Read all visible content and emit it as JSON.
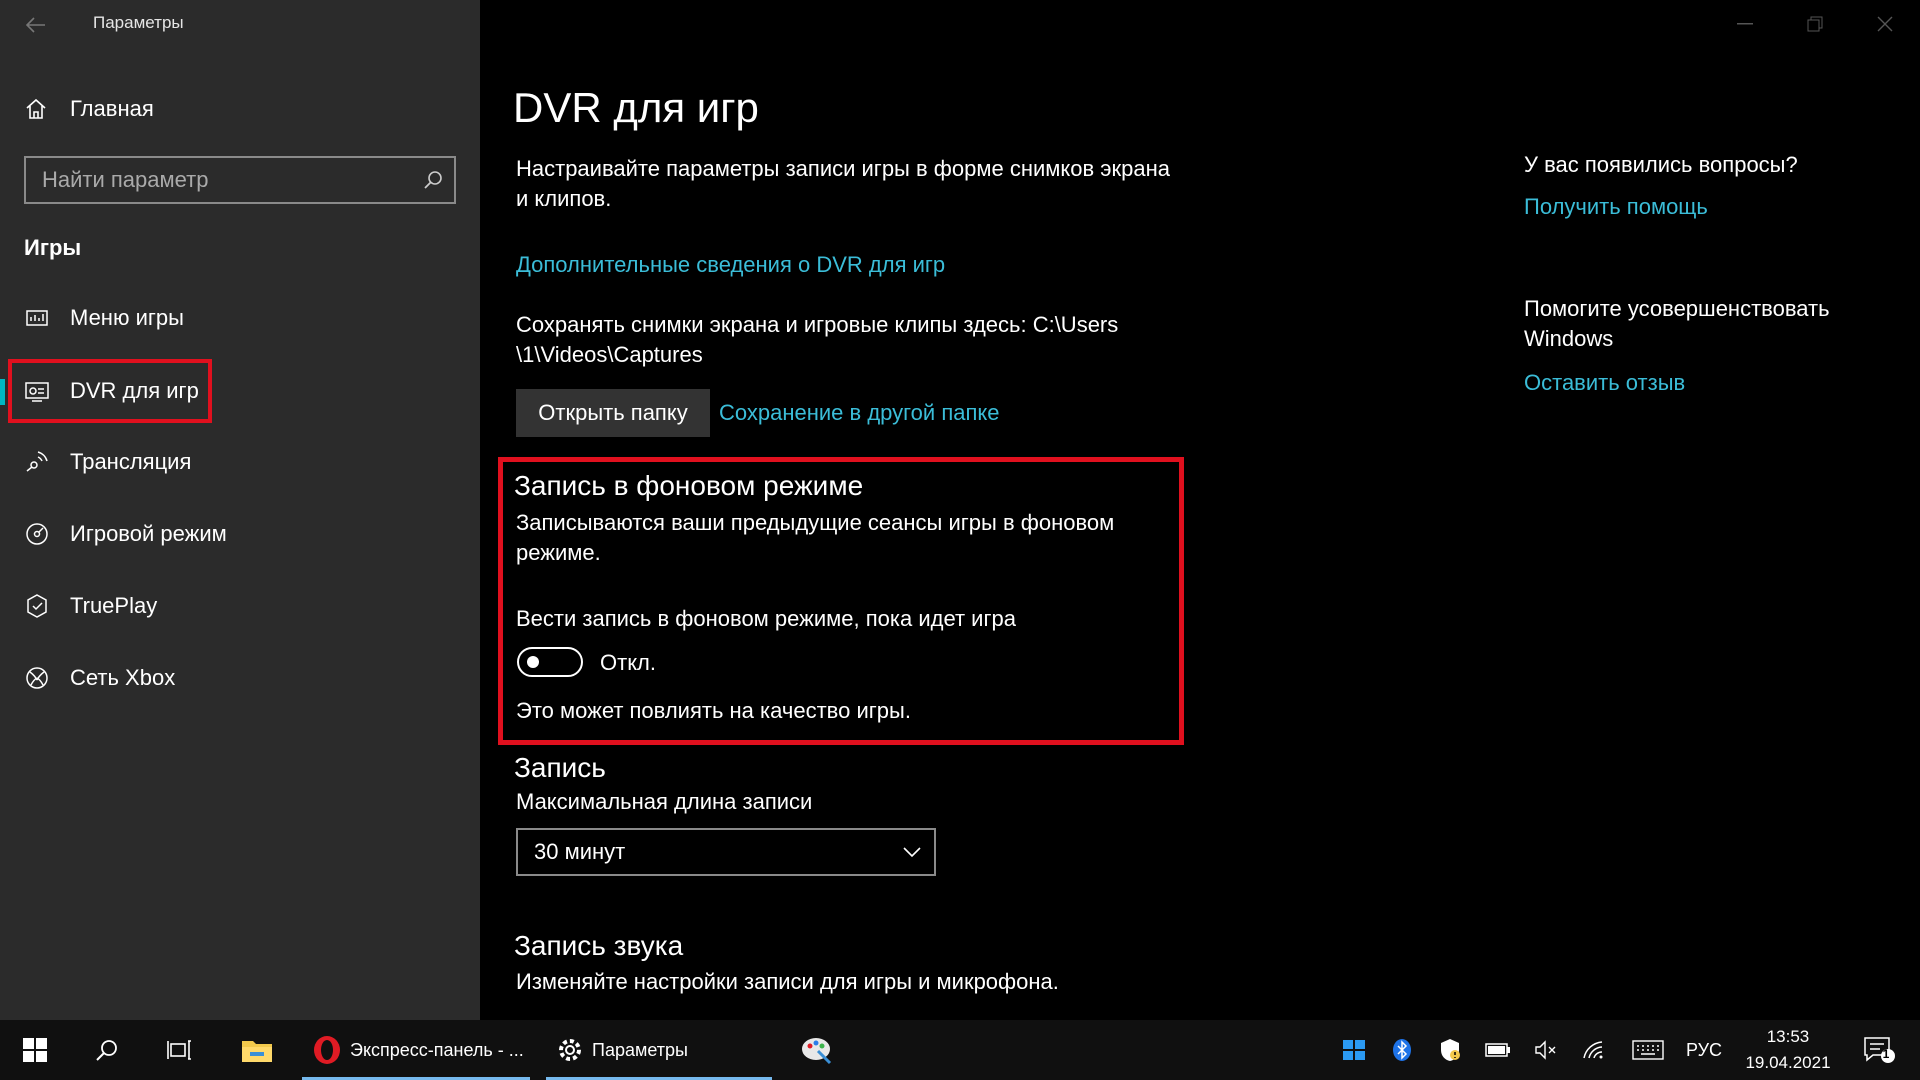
{
  "window": {
    "title": "Параметры"
  },
  "sidebar": {
    "home_label": "Главная",
    "search_placeholder": "Найти параметр",
    "section_title": "Игры",
    "items": [
      {
        "label": "Меню игры",
        "icon": "game-bar-icon"
      },
      {
        "label": "DVR для игр",
        "icon": "game-dvr-icon",
        "active": true
      },
      {
        "label": "Трансляция",
        "icon": "broadcast-icon"
      },
      {
        "label": "Игровой режим",
        "icon": "game-mode-icon"
      },
      {
        "label": "TruePlay",
        "icon": "trueplay-icon"
      },
      {
        "label": "Сеть Xbox",
        "icon": "xbox-icon"
      }
    ]
  },
  "main": {
    "title": "DVR для игр",
    "description_line1": "Настраивайте параметры записи игры в форме снимков экрана",
    "description_line2": "и клипов.",
    "more_info_link": "Дополнительные сведения о DVR для игр",
    "save_path_line1": "Сохранять снимки экрана и игровые клипы здесь: C:\\Users",
    "save_path_line2": "\\1\\Videos\\Captures",
    "open_folder_button": "Открыть папку",
    "change_folder_link": "Сохранение в другой папке",
    "background": {
      "heading": "Запись в фоновом режиме",
      "desc_line1": "Записываются ваши предыдущие сеансы игры в фоновом",
      "desc_line2": "режиме.",
      "toggle_label": "Вести запись в фоновом режиме, пока идет игра",
      "toggle_state": "Откл.",
      "toggle_on": false,
      "note": "Это может повлиять на качество игры."
    },
    "recording": {
      "heading": "Запись",
      "max_length_label": "Максимальная длина записи",
      "max_length_value": "30 минут"
    },
    "audio": {
      "heading": "Запись звука",
      "desc": "Изменяйте настройки записи для игры и микрофона."
    }
  },
  "help": {
    "question": "У вас появились вопросы?",
    "get_help_link": "Получить помощь",
    "improve_line1": "Помогите усовершенствовать",
    "improve_line2": "Windows",
    "feedback_link": "Оставить отзыв"
  },
  "taskbar": {
    "apps": [
      {
        "label": "Экспресс-панель - ...",
        "icon": "opera-icon"
      },
      {
        "label": "Параметры",
        "icon": "settings-gear-icon"
      }
    ],
    "language": "РУС",
    "time": "13:53",
    "date": "19.04.2021",
    "notification_count": "1"
  },
  "colors": {
    "accent": "#00b7c3",
    "link": "#3bbdd8",
    "highlight": "#e0101e",
    "sidebar_bg": "#2b2b2b",
    "main_bg": "#000000"
  }
}
